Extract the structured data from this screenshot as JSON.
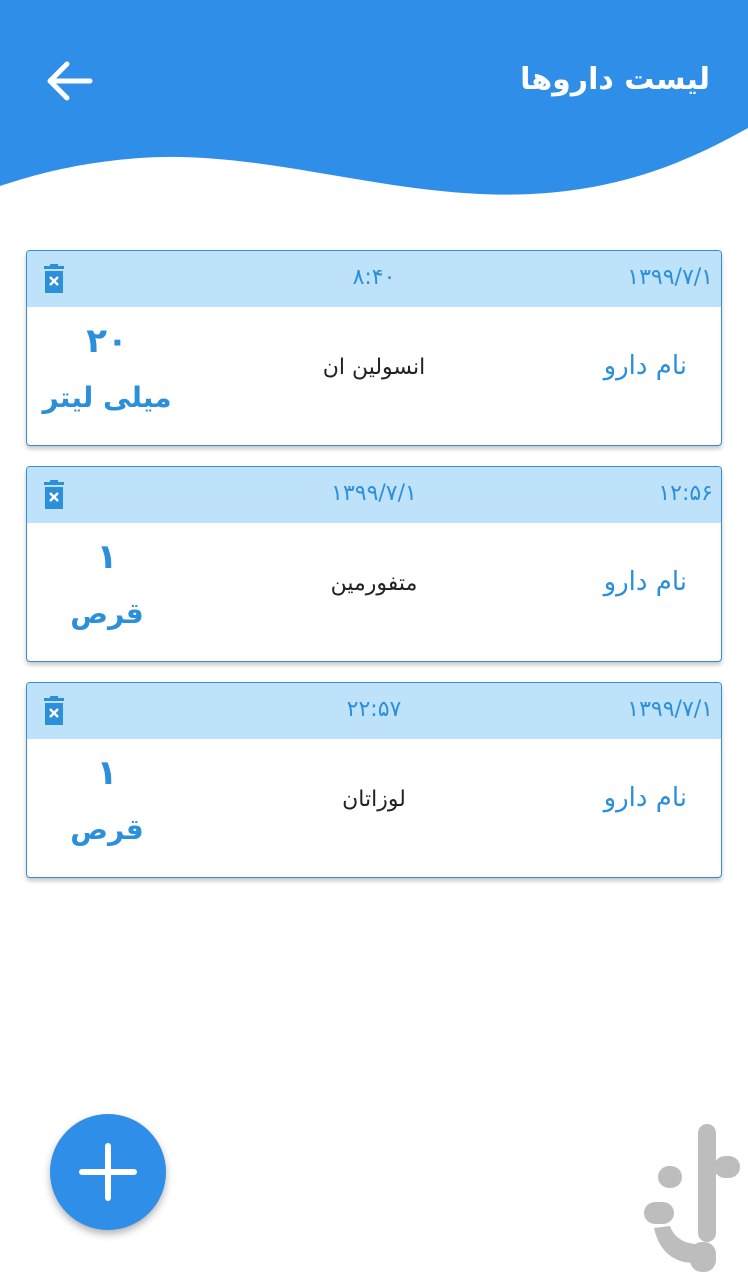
{
  "header": {
    "title": "لیست داروها",
    "back_icon": "arrow-left-icon",
    "color": "#2f8fe8"
  },
  "medications": [
    {
      "date": "۱۳۹۹/۷/۱",
      "time": "۸:۴۰",
      "label": "نام دارو",
      "name": "انسولین ان",
      "amount": "۲۰",
      "unit": "میلی لیتر",
      "head_right": "۱۳۹۹/۷/۱",
      "head_mid": "۸:۴۰"
    },
    {
      "date": "۱۳۹۹/۷/۱",
      "time": "۱۲:۵۶",
      "label": "نام دارو",
      "name": "متفورمین",
      "amount": "۱",
      "unit": "قرص",
      "head_right": "۱۲:۵۶",
      "head_mid": "۱۳۹۹/۷/۱"
    },
    {
      "date": "۱۳۹۹/۷/۱",
      "time": "۲۲:۵۷",
      "label": "نام دارو",
      "name": "لوزاتان",
      "amount": "۱",
      "unit": "قرص",
      "head_right": "۱۳۹۹/۷/۱",
      "head_mid": "۲۲:۵۷"
    }
  ],
  "fab": {
    "icon": "plus-icon"
  },
  "watermark": {
    "icon": "bazaar-logo-icon"
  },
  "colors": {
    "primary": "#2f8fe8",
    "accent_text": "#2b8fd9",
    "card_header": "#bfe2fb"
  }
}
